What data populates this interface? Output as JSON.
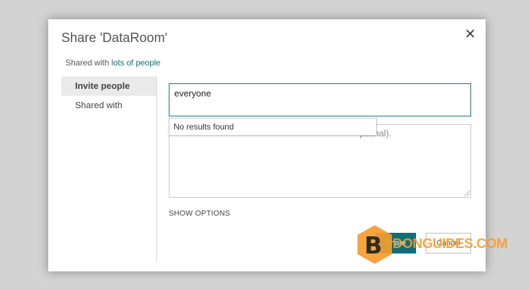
{
  "dialog": {
    "title": "Share 'DataRoom'",
    "close_glyph": "✕",
    "shared_prefix": "Shared with",
    "shared_link": "lots of people"
  },
  "sidebar": {
    "items": [
      {
        "label": "Invite people",
        "active": true
      },
      {
        "label": "Shared with",
        "active": false
      }
    ]
  },
  "invite": {
    "people_value": "everyone",
    "dropdown_text": "No results found",
    "message_visible_tail": "ptional).",
    "show_options": "SHOW OPTIONS"
  },
  "buttons": {
    "share": "Share",
    "cancel": "Cancel"
  },
  "watermark": {
    "letter": "B",
    "text": "DONGUIDES.COM",
    "color": "#f59c2d"
  },
  "colors": {
    "accent": "#0f6e79",
    "backdrop": "#d3d3d3"
  }
}
